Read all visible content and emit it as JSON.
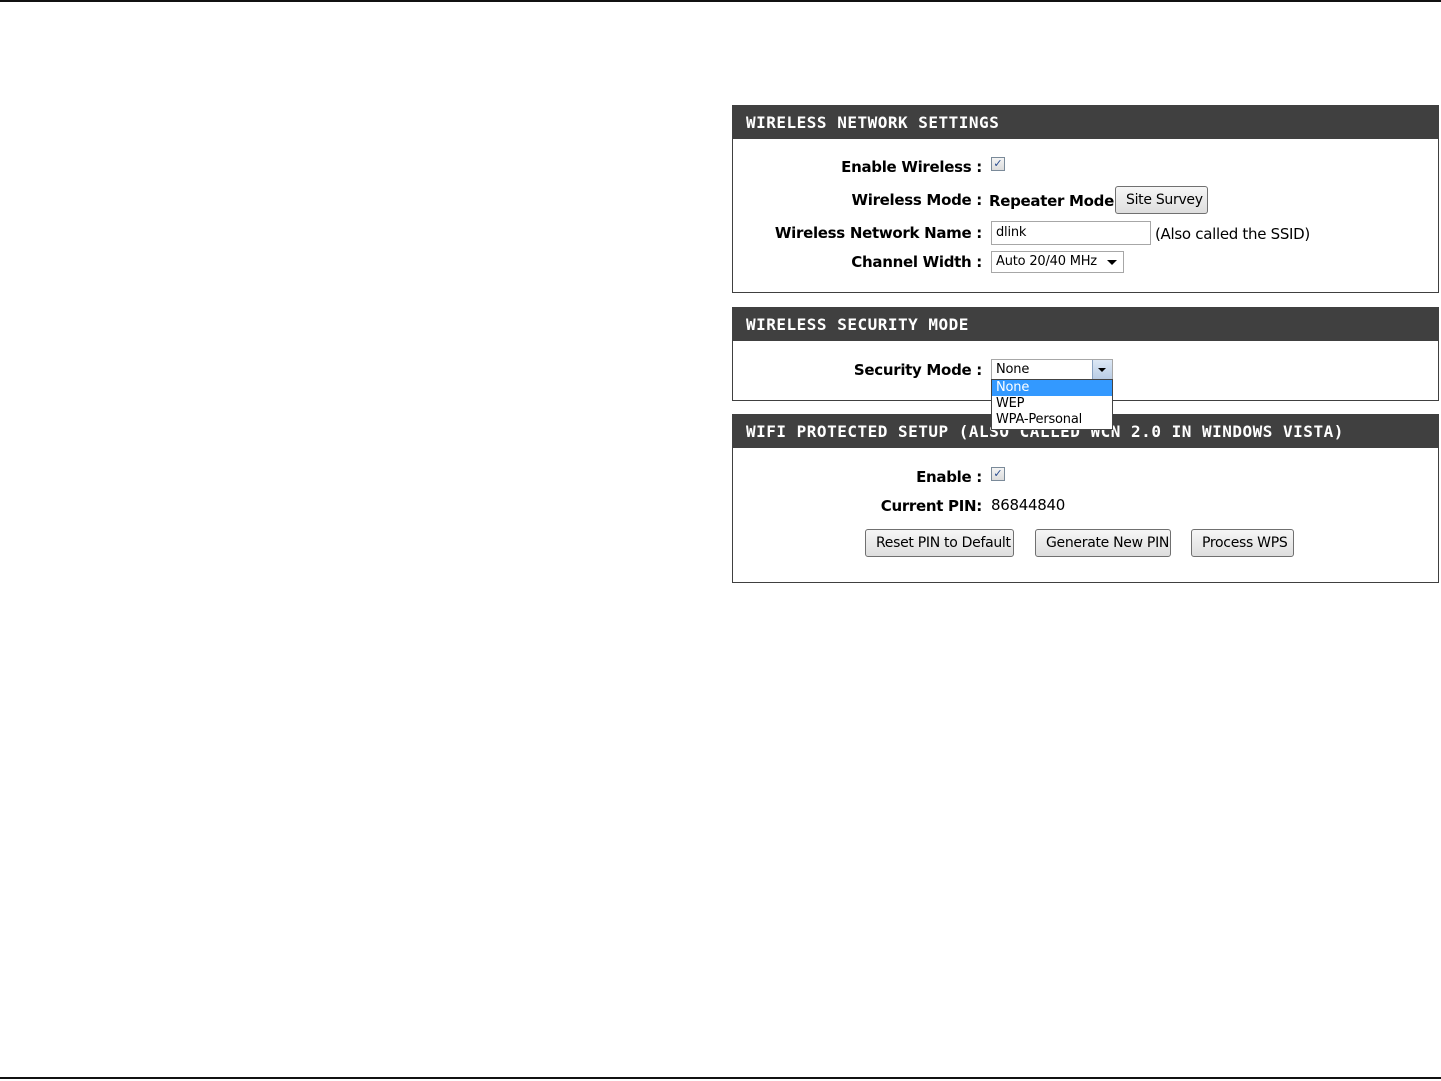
{
  "wireless_network_settings": {
    "title": "WIRELESS NETWORK SETTINGS",
    "enable_wireless_label": "Enable Wireless :",
    "enable_wireless_checked": true,
    "wireless_mode_label": "Wireless Mode :",
    "wireless_mode_value": "Repeater Mode",
    "site_survey_button": "Site Survey",
    "network_name_label": "Wireless Network Name :",
    "network_name_value": "dlink",
    "network_name_hint": "(Also called the SSID)",
    "channel_width_label": "Channel Width :",
    "channel_width_value": "Auto 20/40 MHz"
  },
  "wireless_security_mode": {
    "title": "WIRELESS SECURITY MODE",
    "security_mode_label": "Security Mode :",
    "security_mode_value": "None",
    "security_mode_options": [
      "None",
      "WEP",
      "WPA-Personal"
    ]
  },
  "wifi_protected_setup": {
    "title": "WIFI PROTECTED SETUP (ALSO CALLED WCN 2.0 IN WINDOWS VISTA)",
    "enable_label": "Enable :",
    "enable_checked": true,
    "current_pin_label": "Current PIN:",
    "current_pin_value": "86844840",
    "reset_pin_button": "Reset PIN to Default",
    "generate_pin_button": "Generate New PIN",
    "process_wps_button": "Process WPS"
  },
  "colors": {
    "header_bg": "#404040",
    "header_text": "#ffffff",
    "selected_option_bg": "#3399ff"
  },
  "icons": {
    "checkbox_check": "check-icon",
    "select_arrow": "chevron-down-icon"
  }
}
